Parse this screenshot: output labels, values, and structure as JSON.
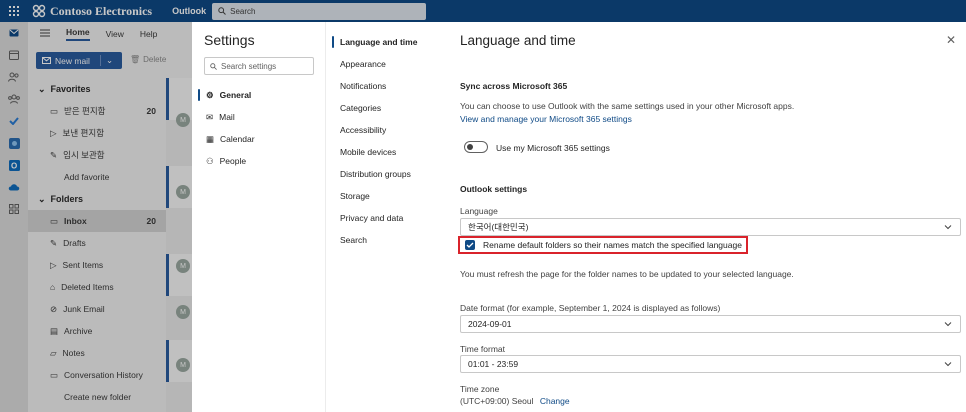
{
  "topbar": {
    "brand": "Contoso Electronics",
    "app": "Outlook",
    "search_placeholder": "Search"
  },
  "ribbon": {
    "tabs": [
      "Home",
      "View",
      "Help"
    ],
    "new_mail": "New mail",
    "delete": "Delete"
  },
  "folders": {
    "favorites_header": "Favorites",
    "favorites": [
      {
        "label": "받은 편지함",
        "count": "20"
      },
      {
        "label": "보낸 편지함",
        "count": ""
      },
      {
        "label": "임시 보관함",
        "count": ""
      }
    ],
    "add_favorite": "Add favorite",
    "folders_header": "Folders",
    "items": [
      {
        "label": "Inbox",
        "count": "20"
      },
      {
        "label": "Drafts",
        "count": ""
      },
      {
        "label": "Sent Items",
        "count": ""
      },
      {
        "label": "Deleted Items",
        "count": ""
      },
      {
        "label": "Junk Email",
        "count": ""
      },
      {
        "label": "Archive",
        "count": ""
      },
      {
        "label": "Notes",
        "count": ""
      },
      {
        "label": "Conversation History",
        "count": ""
      }
    ],
    "create_new": "Create new folder"
  },
  "message_avatars": [
    "M",
    "M",
    "M",
    "M",
    "M"
  ],
  "settings": {
    "title": "Settings",
    "search_placeholder": "Search settings",
    "nav": [
      {
        "label": "General",
        "active": true
      },
      {
        "label": "Mail",
        "active": false
      },
      {
        "label": "Calendar",
        "active": false
      },
      {
        "label": "People",
        "active": false
      }
    ],
    "subnav": [
      {
        "label": "Language and time",
        "active": true
      },
      {
        "label": "Appearance"
      },
      {
        "label": "Notifications"
      },
      {
        "label": "Categories"
      },
      {
        "label": "Accessibility"
      },
      {
        "label": "Mobile devices"
      },
      {
        "label": "Distribution groups"
      },
      {
        "label": "Storage"
      },
      {
        "label": "Privacy and data"
      },
      {
        "label": "Search"
      }
    ]
  },
  "content": {
    "title": "Language and time",
    "sync_header": "Sync across Microsoft 365",
    "sync_desc": "You can choose to use Outlook with the same settings used in your other Microsoft apps.",
    "sync_link": "View and manage your Microsoft 365 settings",
    "toggle_label": "Use my Microsoft 365 settings",
    "outlook_header": "Outlook settings",
    "language_label": "Language",
    "language_value": "한국어(대한민국)",
    "rename_checkbox": "Rename default folders so their names match the specified language",
    "refresh_note": "You must refresh the page for the folder names to be updated to your selected language.",
    "date_format_label": "Date format (for example, September 1, 2024 is displayed as follows)",
    "date_format_value": "2024-09-01",
    "time_format_label": "Time format",
    "time_format_value": "01:01 - 23:59",
    "time_zone_label": "Time zone",
    "time_zone_value": "(UTC+09:00) Seoul",
    "change_link": "Change"
  },
  "colors": {
    "brand": "#0f4a86",
    "accent": "#2a5b9e",
    "highlight": "#d9232b"
  }
}
